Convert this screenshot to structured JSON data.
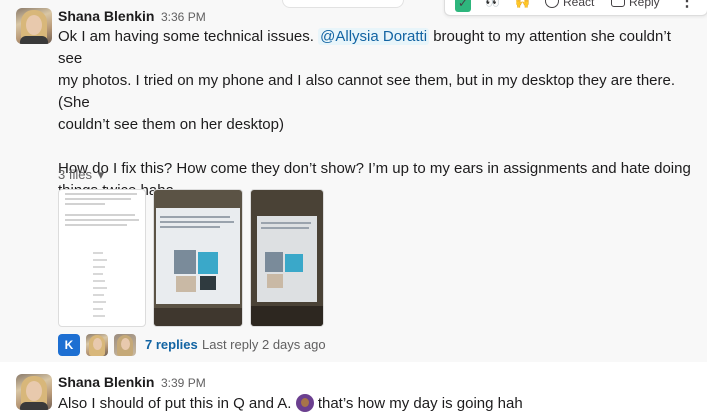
{
  "toolbar": {
    "check_emoji": "✓",
    "eyes_emoji": "👀",
    "raised_hands_emoji": "🙌",
    "react_label": "React",
    "reply_label": "Reply",
    "more_icon": "⋮"
  },
  "message1": {
    "author": "Shana Blenkin",
    "time": "3:36 PM",
    "text_before_mention": "Ok I am having some technical issues.",
    "mention": "@Allysia Doratti",
    "text_after_mention_line1": "brought to my attention she couldn’t see",
    "text_line2": "my photos. I tried on my phone and I also cannot see them, but in my desktop they are there. (She",
    "text_line3": "couldn’t see them on her desktop)",
    "text_line4": "How do I fix this? How come they don’t show? I’m up to my ears in assignments and hate doing",
    "text_line5": "things twice haha.",
    "files_label": "3 files",
    "files_chevron": "▾",
    "thread": {
      "k_avatar_letter": "K",
      "replies": "7 replies",
      "last_reply": "Last reply 2 days ago"
    }
  },
  "message2": {
    "author": "Shana Blenkin",
    "time": "3:39 PM",
    "text_before_emoji": "Also I should of put this in Q and A.",
    "text_after_emoji": "that’s how my day is going hah"
  },
  "colors": {
    "link": "#1264a3",
    "mention_bg": "#e8f5fa",
    "hover_bg": "#f8f8f8",
    "check_green": "#2eb67d"
  }
}
